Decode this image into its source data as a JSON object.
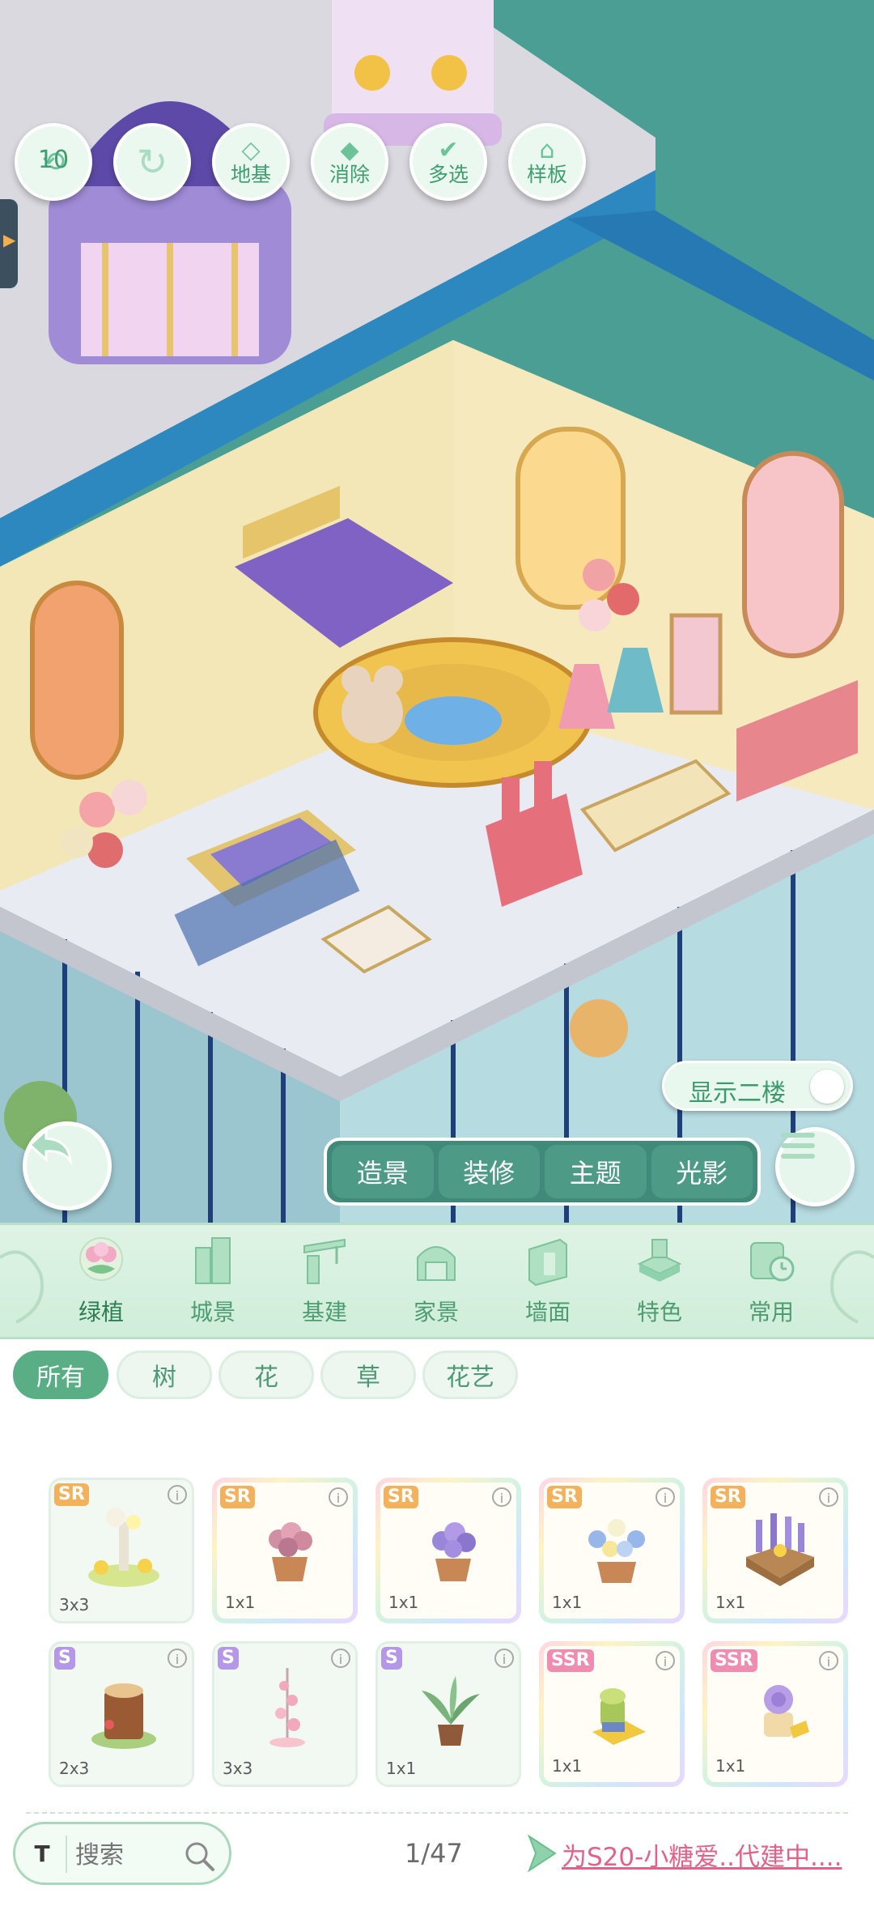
{
  "toolbar": {
    "undo_count": "10",
    "foundation_label": "地基",
    "erase_label": "消除",
    "multiselect_label": "多选",
    "template_label": "样板"
  },
  "show_second_floor": {
    "label": "显示二楼",
    "on": false
  },
  "mode_tabs": [
    {
      "label": "造景",
      "active": true
    },
    {
      "label": "装修",
      "active": false
    },
    {
      "label": "主题",
      "active": false
    },
    {
      "label": "光影",
      "active": false
    }
  ],
  "categories": [
    {
      "label": "绿植",
      "icon": "plant-icon",
      "active": true
    },
    {
      "label": "城景",
      "icon": "city-icon",
      "active": false
    },
    {
      "label": "基建",
      "icon": "crane-icon",
      "active": false
    },
    {
      "label": "家景",
      "icon": "home-gate-icon",
      "active": false
    },
    {
      "label": "墙面",
      "icon": "wall-icon",
      "active": false
    },
    {
      "label": "特色",
      "icon": "special-block-icon",
      "active": false
    },
    {
      "label": "常用",
      "icon": "calendar-clock-icon",
      "active": false
    }
  ],
  "filters": [
    {
      "label": "所有",
      "active": true
    },
    {
      "label": "树",
      "active": false
    },
    {
      "label": "花",
      "active": false
    },
    {
      "label": "草",
      "active": false
    },
    {
      "label": "花艺",
      "active": false
    }
  ],
  "items": [
    {
      "rarity": "SR",
      "size": "3x3",
      "rainbow": false,
      "kind": "flower-sculpture"
    },
    {
      "rarity": "SR",
      "size": "1x1",
      "rainbow": true,
      "kind": "pink-potted-flower"
    },
    {
      "rarity": "SR",
      "size": "1x1",
      "rainbow": true,
      "kind": "purple-potted-flower"
    },
    {
      "rarity": "SR",
      "size": "1x1",
      "rainbow": true,
      "kind": "blue-daisy-pot"
    },
    {
      "rarity": "SR",
      "size": "1x1",
      "rainbow": true,
      "kind": "lavender-basket"
    },
    {
      "rarity": "S",
      "size": "2x3",
      "rainbow": false,
      "kind": "tree-stump"
    },
    {
      "rarity": "S",
      "size": "3x3",
      "rainbow": false,
      "kind": "pink-blossom-tree"
    },
    {
      "rarity": "S",
      "size": "1x1",
      "rainbow": false,
      "kind": "leafy-potted-plant"
    },
    {
      "rarity": "SSR",
      "size": "1x1",
      "rainbow": true,
      "kind": "succulent-on-books"
    },
    {
      "rarity": "SSR",
      "size": "1x1",
      "rainbow": true,
      "kind": "purple-rose-jar"
    }
  ],
  "info_glyph": "i",
  "search": {
    "prefix_icon": "T",
    "placeholder": "搜索"
  },
  "pagination": "1/47",
  "builder_text": "为S20-小糖爱..代建中....",
  "colors": {
    "accent": "#5aae86",
    "builder_link": "#e1628a",
    "scene_bg": "#4a9e94"
  }
}
